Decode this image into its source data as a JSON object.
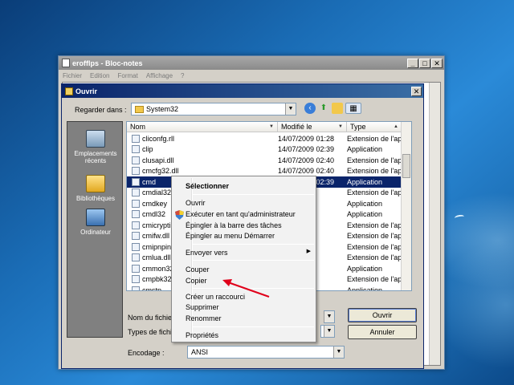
{
  "notepad": {
    "title": "erofflps - Bloc-notes",
    "menu": [
      "Fichier",
      "Edition",
      "Format",
      "Affichage",
      "?"
    ]
  },
  "dialog": {
    "title": "Ouvrir",
    "look_in_label": "Regarder dans :",
    "look_in_value": "System32",
    "places": [
      "Emplacements récents",
      "Bibliothèques",
      "Ordinateur"
    ],
    "columns": [
      "Nom",
      "Modifié le",
      "Type"
    ],
    "files": [
      {
        "name": "cliconfg.rll",
        "date": "14/07/2009 01:28",
        "type": "Extension de l'ap..."
      },
      {
        "name": "clip",
        "date": "14/07/2009 02:39",
        "type": "Application"
      },
      {
        "name": "clusapi.dll",
        "date": "14/07/2009 02:40",
        "type": "Extension de l'ap..."
      },
      {
        "name": "cmcfg32.dll",
        "date": "14/07/2009 02:40",
        "type": "Extension de l'ap..."
      },
      {
        "name": "cmd",
        "date": "14/07/2009 02:39",
        "type": "Application",
        "selected": true
      },
      {
        "name": "cmdial32.",
        "date": "02:40",
        "type": "Extension de l'ap..."
      },
      {
        "name": "cmdkey",
        "date": "02:39",
        "type": "Application"
      },
      {
        "name": "cmdl32",
        "date": "02:39",
        "type": "Application"
      },
      {
        "name": "cmicryptin",
        "date": "02:40",
        "type": "Extension de l'ap..."
      },
      {
        "name": "cmifw.dll",
        "date": "02:40",
        "type": "Extension de l'ap..."
      },
      {
        "name": "cmipnpins",
        "date": "02:40",
        "type": "Extension de l'ap..."
      },
      {
        "name": "cmlua.dll",
        "date": "02:40",
        "type": "Extension de l'ap..."
      },
      {
        "name": "cmmon32",
        "date": "02:39",
        "type": "Application"
      },
      {
        "name": "cmpbk32.",
        "date": "02:40",
        "type": "Extension de l'ap..."
      },
      {
        "name": "cmstp",
        "date": "02:39",
        "type": "Application"
      }
    ],
    "filename_label": "Nom du fichier",
    "filetype_label": "Types de fichie",
    "encoding_label": "Encodage :",
    "encoding_value": "ANSI",
    "open_button": "Ouvrir",
    "cancel_button": "Annuler"
  },
  "context_menu": {
    "header": "Sélectionner",
    "items": [
      "Ouvrir",
      "Exécuter en tant qu'administrateur",
      "Épingler à la barre des tâches",
      "Épingler au menu Démarrer",
      "Envoyer vers",
      "Couper",
      "Copier",
      "Créer un raccourci",
      "Supprimer",
      "Renommer",
      "Propriétés"
    ]
  },
  "colors": {
    "selection": "#0a246a",
    "annotation_arrow": "#e0001a"
  }
}
